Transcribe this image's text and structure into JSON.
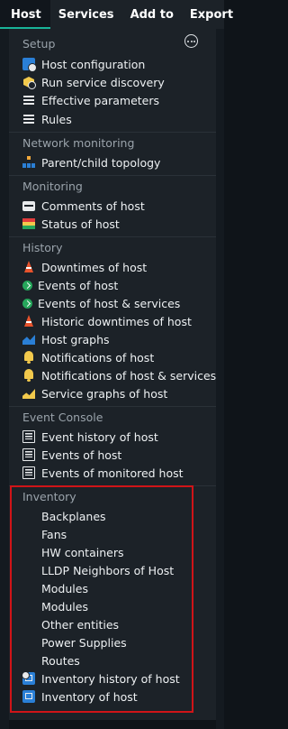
{
  "menubar": {
    "tabs": [
      {
        "label": "Host",
        "active": true
      },
      {
        "label": "Services"
      },
      {
        "label": "Add to"
      },
      {
        "label": "Export"
      }
    ]
  },
  "sections": [
    {
      "title": "Setup",
      "items": [
        {
          "label": "Host configuration",
          "icon": "host-config-icon"
        },
        {
          "label": "Run service discovery",
          "icon": "service-discovery-icon"
        },
        {
          "label": "Effective parameters",
          "icon": "parameters-icon"
        },
        {
          "label": "Rules",
          "icon": "rules-icon"
        }
      ]
    },
    {
      "title": "Network monitoring",
      "items": [
        {
          "label": "Parent/child topology",
          "icon": "topology-icon"
        }
      ]
    },
    {
      "title": "Monitoring",
      "items": [
        {
          "label": "Comments of host",
          "icon": "comment-icon"
        },
        {
          "label": "Status of host",
          "icon": "status-icon"
        }
      ]
    },
    {
      "title": "History",
      "items": [
        {
          "label": "Downtimes of host",
          "icon": "downtime-cone-icon"
        },
        {
          "label": "Events of host",
          "icon": "events-icon"
        },
        {
          "label": "Events of host & services",
          "icon": "events-icon"
        },
        {
          "label": "Historic downtimes of host",
          "icon": "downtime-cone-icon"
        },
        {
          "label": "Host graphs",
          "icon": "graph-icon"
        },
        {
          "label": "Notifications of host",
          "icon": "bell-icon"
        },
        {
          "label": "Notifications of host & services",
          "icon": "bell-icon"
        },
        {
          "label": "Service graphs of host",
          "icon": "service-graph-icon"
        }
      ]
    },
    {
      "title": "Event Console",
      "items": [
        {
          "label": "Event history of host",
          "icon": "event-console-icon"
        },
        {
          "label": "Events of host",
          "icon": "event-console-icon"
        },
        {
          "label": "Events of monitored host",
          "icon": "event-console-icon"
        }
      ]
    },
    {
      "title": "Inventory",
      "items": [
        {
          "label": "Backplanes"
        },
        {
          "label": "Fans"
        },
        {
          "label": "HW containers"
        },
        {
          "label": "LLDP Neighbors of Host"
        },
        {
          "label": "Modules"
        },
        {
          "label": "Modules"
        },
        {
          "label": "Other entities"
        },
        {
          "label": "Power Supplies"
        },
        {
          "label": "Routes"
        },
        {
          "label": "Inventory history of host",
          "icon": "inventory-history-icon"
        },
        {
          "label": "Inventory of host",
          "icon": "inventory-icon"
        }
      ]
    }
  ],
  "colors": {
    "accent": "#19b398",
    "highlight_border": "#d01418",
    "panel_bg": "#1c2228",
    "heading_text": "#9aa3ab",
    "item_text": "#eef1f3"
  }
}
